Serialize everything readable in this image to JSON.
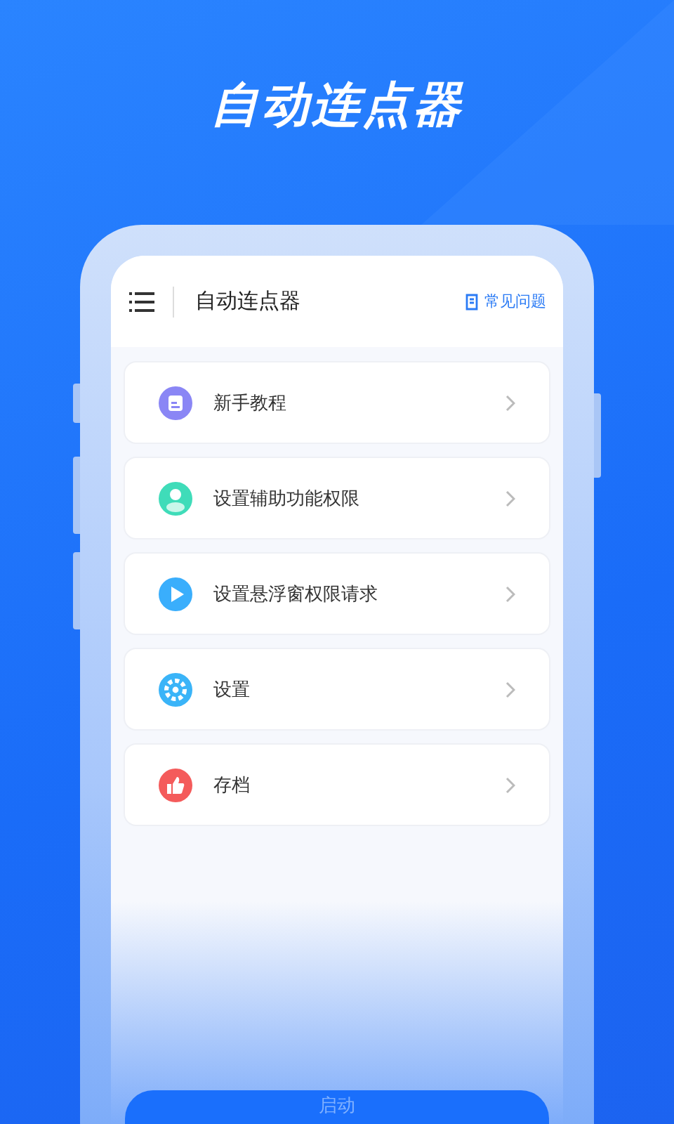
{
  "headline": "自动连点器",
  "header": {
    "title": "自动连点器",
    "faq_link": "常见问题"
  },
  "menu": [
    {
      "kind": "guide",
      "label": "新手教程"
    },
    {
      "kind": "person",
      "label": "设置辅助功能权限"
    },
    {
      "kind": "play",
      "label": "设置悬浮窗权限请求"
    },
    {
      "kind": "gear",
      "label": "设置"
    },
    {
      "kind": "thumb",
      "label": "存档"
    }
  ],
  "start_button": "启动"
}
